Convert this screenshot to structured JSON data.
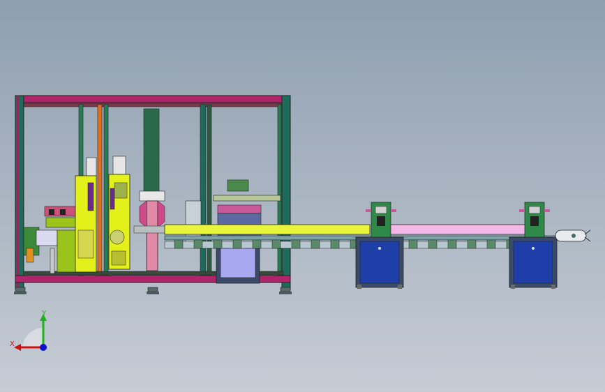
{
  "triad": {
    "x_label": "X",
    "y_label": "Y"
  },
  "colors": {
    "background_top": "#8f9fb0",
    "background_bottom": "#c6ccd4",
    "frame_magenta": "#b0246a",
    "frame_teal": "#1f6b5a",
    "rail_yellow": "#e9f53a",
    "rail_pink": "#f3b8e8",
    "cabinet_blue": "#1f3fa8",
    "axis_x": "#d01010",
    "axis_y": "#20b020",
    "axis_z": "#1010d0"
  }
}
